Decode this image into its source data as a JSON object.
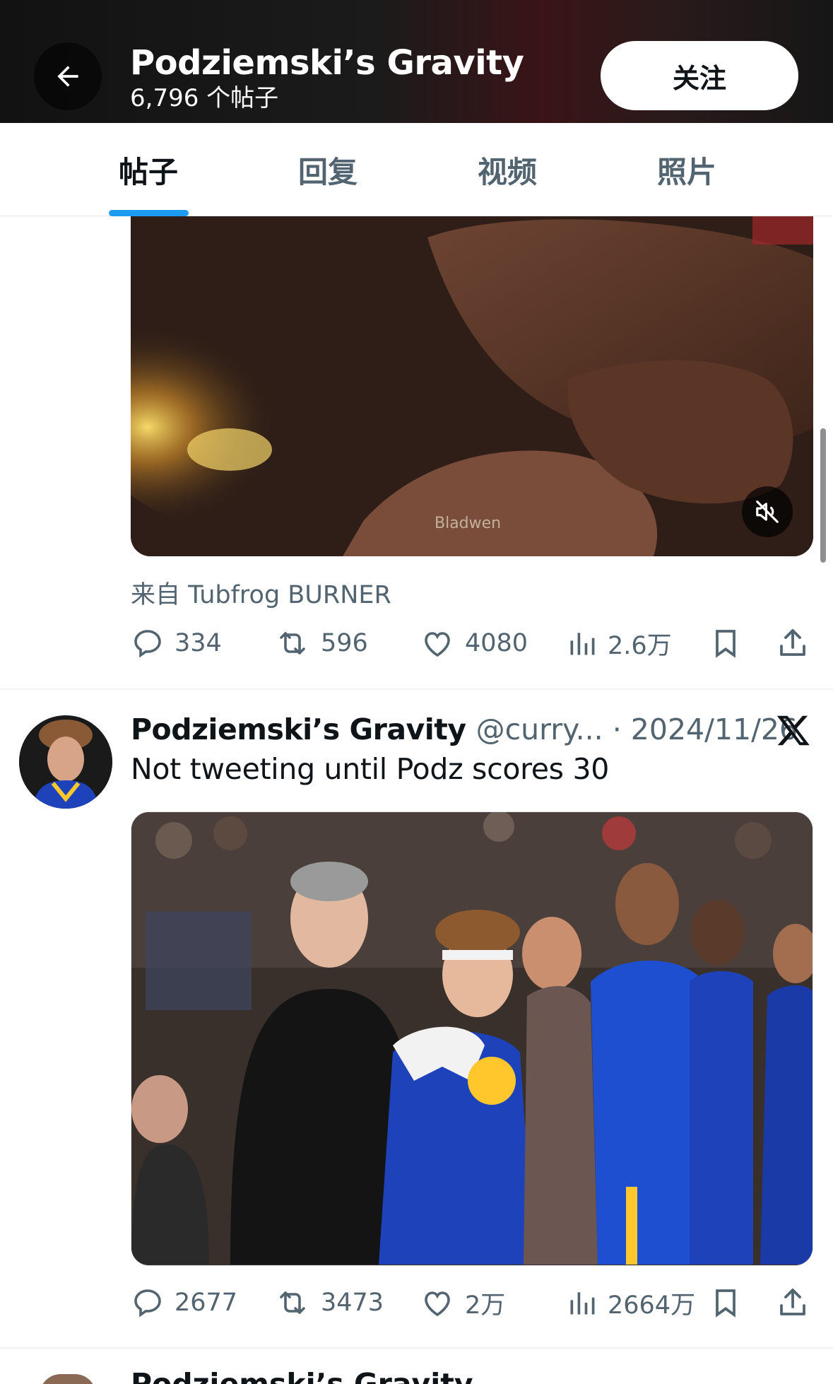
{
  "header": {
    "title": "Podziemski’s Gravity",
    "post_count": "6,796 个帖子",
    "follow_label": "关注"
  },
  "tabs": [
    {
      "label": "帖子",
      "active": true
    },
    {
      "label": "回复",
      "active": false
    },
    {
      "label": "视频",
      "active": false
    },
    {
      "label": "照片",
      "active": false
    }
  ],
  "post1": {
    "video_watermark": "Bladwen",
    "source": "来自 Tubfrog BURNER",
    "stats": {
      "replies": "334",
      "reposts": "596",
      "likes": "4080",
      "views": "2.6万"
    }
  },
  "post2": {
    "author_name": "Podziemski’s Gravity",
    "handle_date": "@curry... · 2024/11/26",
    "text": "Not tweeting until Podz scores 30",
    "stats": {
      "replies": "2677",
      "reposts": "3473",
      "likes": "2万",
      "views": "2664万"
    }
  },
  "post3_peek": {
    "author_name": "Podziemski’s Gravity"
  },
  "colors": {
    "accent": "#1d9bf0",
    "text_primary": "#0f1419",
    "text_secondary": "#536471",
    "warriors_blue": "#1d42ba",
    "warriors_gold": "#ffc72c"
  }
}
